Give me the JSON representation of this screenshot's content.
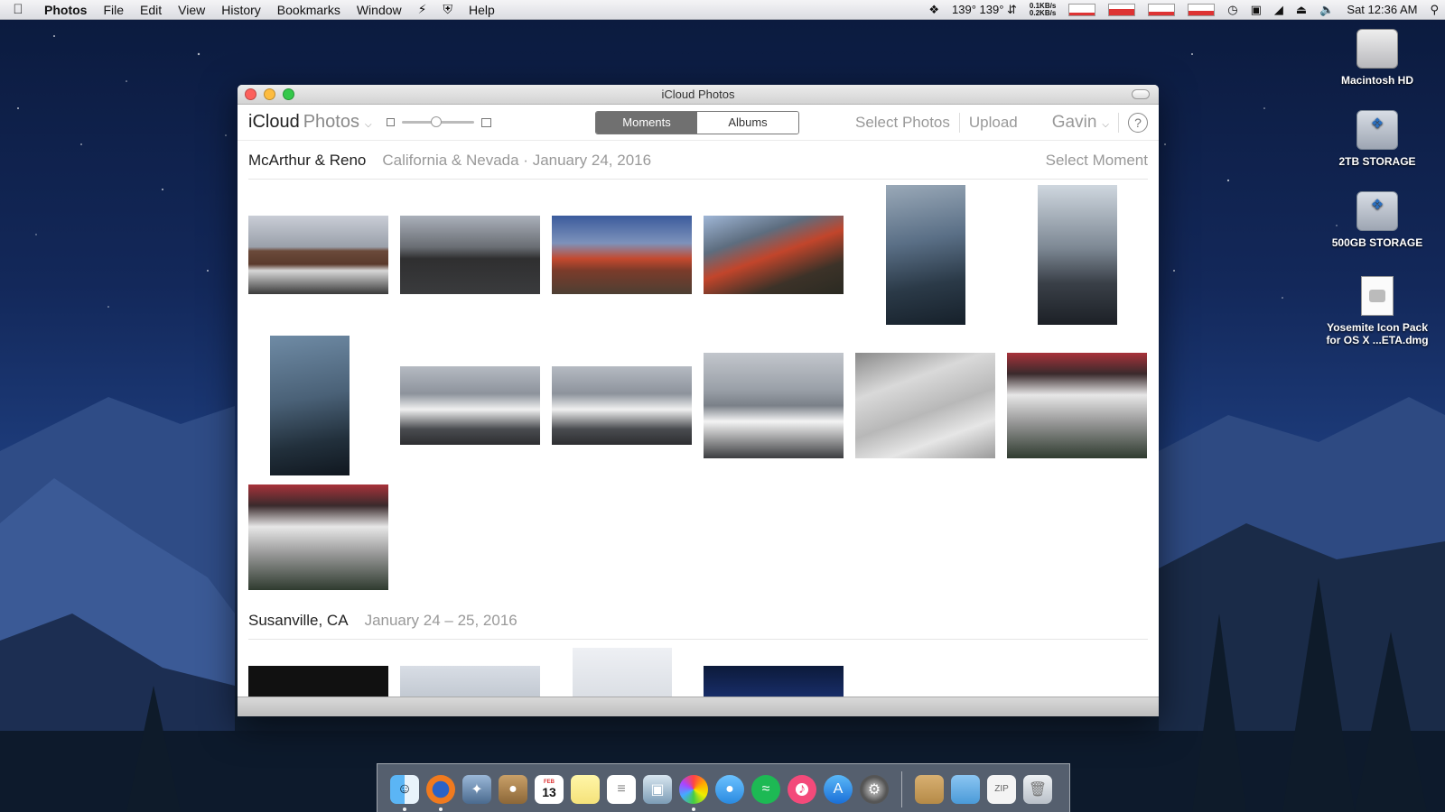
{
  "menubar": {
    "app_name": "Photos",
    "menus": [
      "File",
      "Edit",
      "View",
      "History",
      "Bookmarks",
      "Window",
      "Help"
    ],
    "temps": "139° 139°",
    "net_up": "0.1KB/s",
    "net_down": "0.2KB/s",
    "clock": "Sat 12:36 AM"
  },
  "desktop": {
    "icons": [
      {
        "label": "Macintosh HD"
      },
      {
        "label": "2TB STORAGE"
      },
      {
        "label": "500GB STORAGE"
      },
      {
        "label_line1": "Yosemite Icon Pack",
        "label_line2": "for OS X ...ETA.dmg"
      }
    ]
  },
  "window": {
    "title": "iCloud Photos",
    "toolbar": {
      "brand_icloud": "iCloud",
      "brand_photos": "Photos",
      "seg_moments": "Moments",
      "seg_albums": "Albums",
      "select_photos": "Select Photos",
      "upload": "Upload",
      "user": "Gavin",
      "help": "?"
    },
    "moments": [
      {
        "place": "McArthur & Reno",
        "sub": "California & Nevada · January 24, 2016",
        "action": "Select Moment"
      },
      {
        "place": "Susanville, CA",
        "sub": "January 24 – 25, 2016",
        "action": ""
      }
    ]
  },
  "dock": {
    "apps": [
      "finder",
      "firefox",
      "preview",
      "contacts",
      "calendar",
      "notes",
      "reminders",
      "photo-booth",
      "photos",
      "messages",
      "spotify",
      "itunes",
      "app-store",
      "system-preferences",
      "documents",
      "folder",
      "zip",
      "trash"
    ],
    "calendar_month": "FEB",
    "calendar_day": "13"
  }
}
